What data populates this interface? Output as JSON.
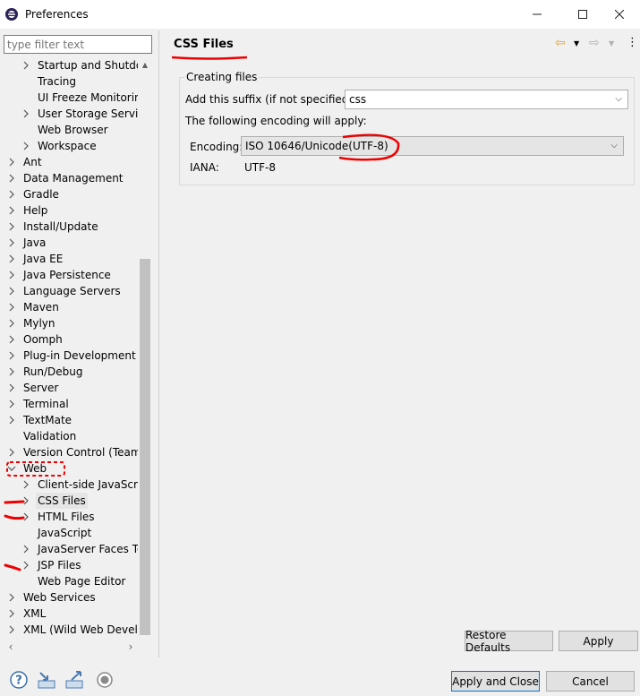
{
  "window": {
    "title": "Preferences"
  },
  "filter": {
    "placeholder": "type filter text"
  },
  "tree": {
    "items": [
      {
        "label": "Startup and Shutdow",
        "level": 1,
        "expandable": true
      },
      {
        "label": "Tracing",
        "level": 1,
        "expandable": false
      },
      {
        "label": "UI Freeze Monitoring",
        "level": 1,
        "expandable": false
      },
      {
        "label": "User Storage Service",
        "level": 1,
        "expandable": true
      },
      {
        "label": "Web Browser",
        "level": 1,
        "expandable": false
      },
      {
        "label": "Workspace",
        "level": 1,
        "expandable": true
      },
      {
        "label": "Ant",
        "level": 0,
        "expandable": true
      },
      {
        "label": "Data Management",
        "level": 0,
        "expandable": true
      },
      {
        "label": "Gradle",
        "level": 0,
        "expandable": true
      },
      {
        "label": "Help",
        "level": 0,
        "expandable": true
      },
      {
        "label": "Install/Update",
        "level": 0,
        "expandable": true
      },
      {
        "label": "Java",
        "level": 0,
        "expandable": true
      },
      {
        "label": "Java EE",
        "level": 0,
        "expandable": true
      },
      {
        "label": "Java Persistence",
        "level": 0,
        "expandable": true
      },
      {
        "label": "Language Servers",
        "level": 0,
        "expandable": true
      },
      {
        "label": "Maven",
        "level": 0,
        "expandable": true
      },
      {
        "label": "Mylyn",
        "level": 0,
        "expandable": true
      },
      {
        "label": "Oomph",
        "level": 0,
        "expandable": true
      },
      {
        "label": "Plug-in Development",
        "level": 0,
        "expandable": true
      },
      {
        "label": "Run/Debug",
        "level": 0,
        "expandable": true
      },
      {
        "label": "Server",
        "level": 0,
        "expandable": true
      },
      {
        "label": "Terminal",
        "level": 0,
        "expandable": true
      },
      {
        "label": "TextMate",
        "level": 0,
        "expandable": true
      },
      {
        "label": "Validation",
        "level": 0,
        "expandable": false
      },
      {
        "label": "Version Control (Team)",
        "level": 0,
        "expandable": true
      },
      {
        "label": "Web",
        "level": 0,
        "expandable": true,
        "expanded": true
      },
      {
        "label": "Client-side JavaScript",
        "level": 1,
        "expandable": true
      },
      {
        "label": "CSS Files",
        "level": 1,
        "expandable": true,
        "selected": true
      },
      {
        "label": "HTML Files",
        "level": 1,
        "expandable": true
      },
      {
        "label": "JavaScript",
        "level": 1,
        "expandable": false
      },
      {
        "label": "JavaServer Faces Too",
        "level": 1,
        "expandable": true
      },
      {
        "label": "JSP Files",
        "level": 1,
        "expandable": true
      },
      {
        "label": "Web Page Editor",
        "level": 1,
        "expandable": false
      },
      {
        "label": "Web Services",
        "level": 0,
        "expandable": true
      },
      {
        "label": "XML",
        "level": 0,
        "expandable": true
      },
      {
        "label": "XML (Wild Web Develop",
        "level": 0,
        "expandable": true
      }
    ]
  },
  "page": {
    "title": "CSS Files",
    "group_label": "Creating files",
    "suffix_label": "Add this suffix (if not specified):",
    "suffix_value": "css",
    "encoding_note": "The following encoding will apply:",
    "encoding_label": "Encoding:",
    "encoding_value": "ISO 10646/Unicode(UTF-8)",
    "iana_label": "IANA:",
    "iana_value": "UTF-8"
  },
  "buttons": {
    "restore_defaults": "Restore Defaults",
    "apply": "Apply",
    "apply_and_close": "Apply and Close",
    "cancel": "Cancel"
  },
  "icons": {
    "back": "back-arrow-icon",
    "forward": "forward-arrow-icon",
    "menu": "view-menu-icon",
    "help": "help-icon",
    "import": "import-icon",
    "export": "export-icon",
    "record": "record-icon"
  },
  "colors": {
    "annotation": "#e00000",
    "default_button_border": "#0078d7",
    "selection": "#e5e5e5",
    "back_arrow": "#e8a020"
  }
}
